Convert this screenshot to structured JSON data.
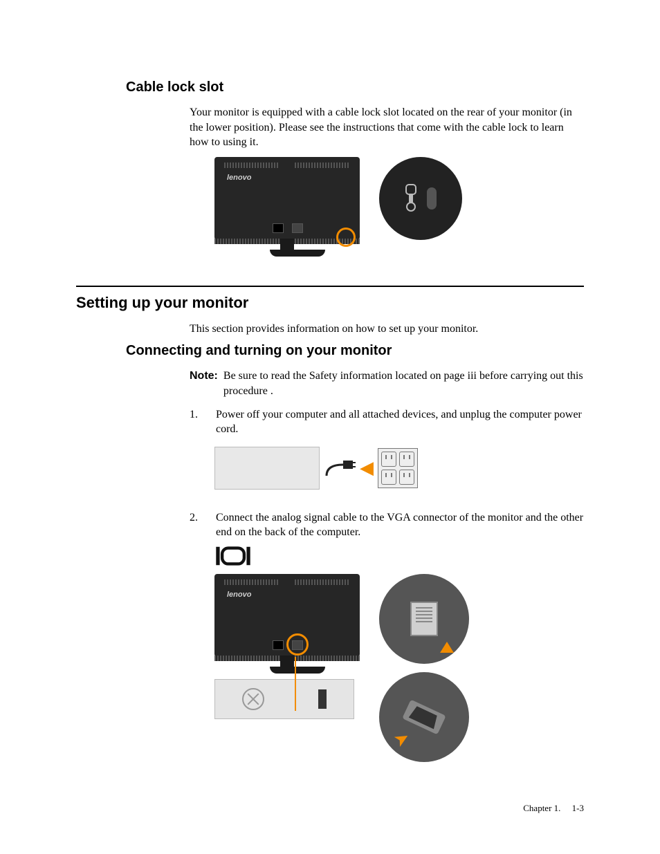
{
  "section1": {
    "heading": "Cable lock slot",
    "body": "Your monitor is equipped with a cable lock slot located on the rear of your monitor (in the lower position). Please see the instructions that come with the cable lock to learn how to using it.",
    "monitor_logo": "lenovo"
  },
  "section2": {
    "heading": "Setting up your monitor",
    "intro": "This section provides information on how to set up your monitor."
  },
  "section3": {
    "heading": "Connecting and turning on your monitor",
    "note_label": "Note:",
    "note_text": "Be sure to read the Safety information located on page iii before carrying out this procedure .",
    "steps": [
      {
        "num": "1.",
        "text": "Power off your computer and all attached devices, and unplug the computer power cord."
      },
      {
        "num": "2.",
        "text": "Connect the analog signal cable to the VGA connector of  the monitor and the other end on the back of the computer."
      }
    ],
    "monitor_logo": "lenovo"
  },
  "footer": {
    "chapter": "Chapter 1.",
    "page": "1-3"
  }
}
